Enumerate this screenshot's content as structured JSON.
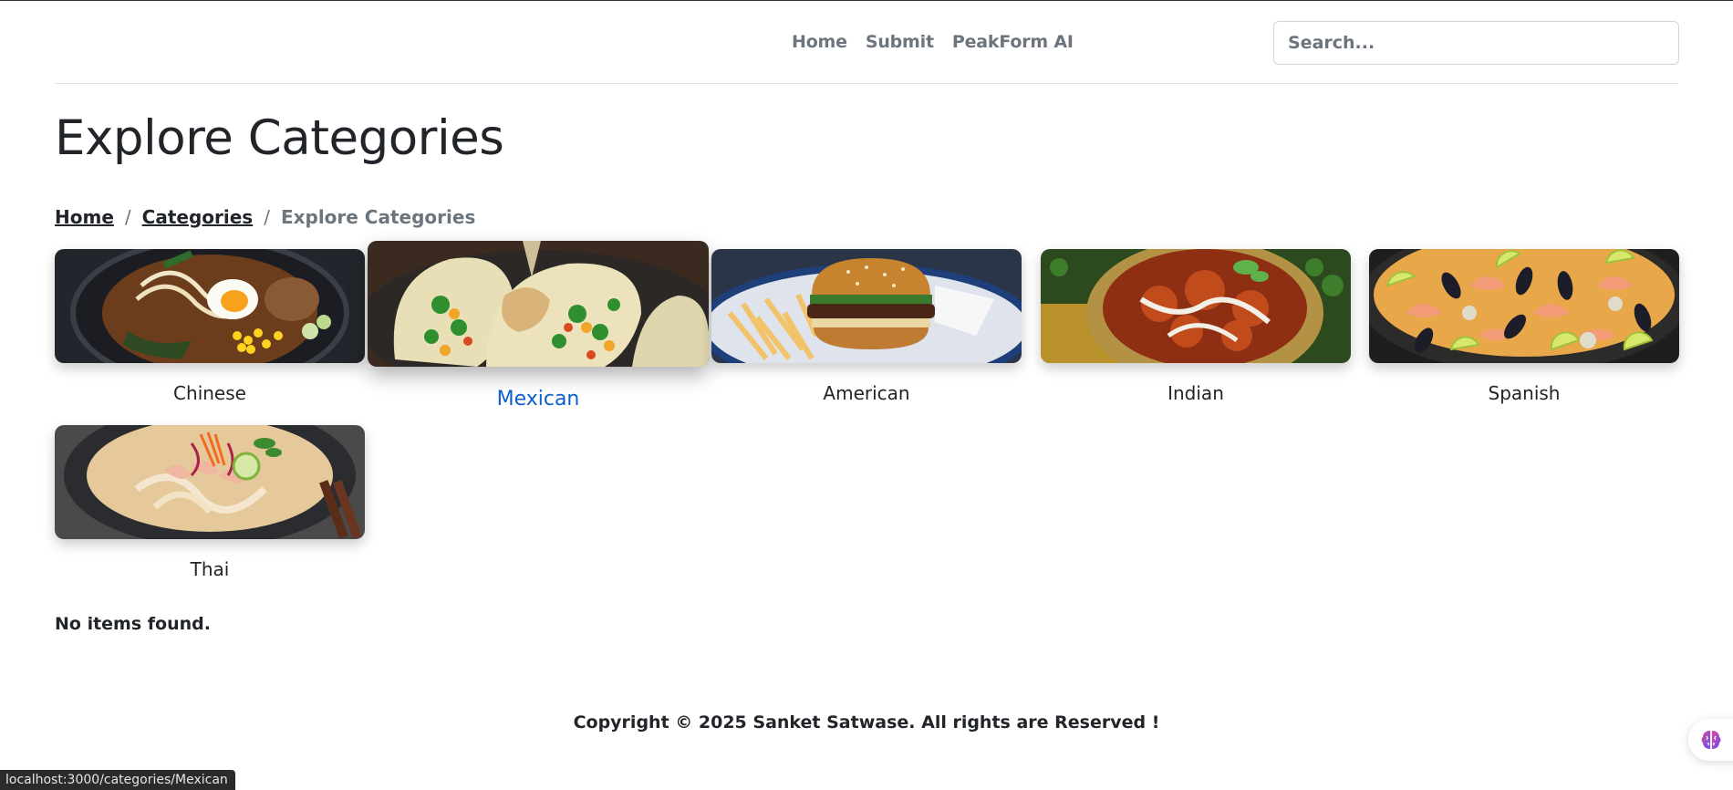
{
  "header": {
    "nav": [
      "Home",
      "Submit",
      "PeakForm AI"
    ],
    "search_placeholder": "Search..."
  },
  "page_title": "Explore Categories",
  "breadcrumb": {
    "items": [
      "Home",
      "Categories"
    ],
    "current": "Explore Categories"
  },
  "categories": [
    {
      "label": "Chinese",
      "icon": "ramen-bowl-image"
    },
    {
      "label": "Mexican",
      "icon": "tacos-image",
      "hovered": true
    },
    {
      "label": "American",
      "icon": "burger-fries-image"
    },
    {
      "label": "Indian",
      "icon": "curry-bowl-image"
    },
    {
      "label": "Spanish",
      "icon": "paella-image"
    },
    {
      "label": "Thai",
      "icon": "thai-curry-noodles-image"
    }
  ],
  "empty_message": "No items found.",
  "footer": "Copyright © 2025 Sanket Satwase. All rights are Reserved !",
  "status_url": "localhost:3000/categories/Mexican",
  "colors": {
    "active_link": "#0d5ecf",
    "muted_text": "#6c757d",
    "status_bar": "#2b2b2b"
  }
}
